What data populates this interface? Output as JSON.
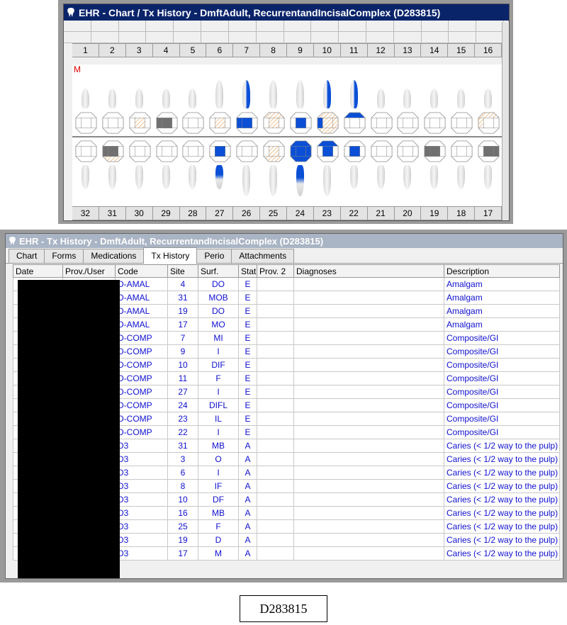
{
  "chart_window": {
    "title": "EHR - Chart / Tx History - DmftAdult, RecurrentandIncisalComplex (D283815)",
    "mesial_marker": "M",
    "upper_tooth_numbers": [
      "1",
      "2",
      "3",
      "4",
      "5",
      "6",
      "7",
      "8",
      "9",
      "10",
      "11",
      "12",
      "13",
      "14",
      "15",
      "16"
    ],
    "lower_tooth_numbers": [
      "32",
      "31",
      "30",
      "29",
      "28",
      "27",
      "26",
      "25",
      "24",
      "23",
      "22",
      "21",
      "20",
      "19",
      "18",
      "17"
    ],
    "colors": {
      "existing_restoration": "#0a4fd6",
      "amalgam": "#707070",
      "caries_hatch": "#f0b070",
      "titlebar": "#0a246a"
    }
  },
  "tx_window": {
    "title": "EHR - Tx History - DmftAdult, RecurrentandIncisalComplex (D283815)",
    "tabs": [
      "Chart",
      "Forms",
      "Medications",
      "Tx History",
      "Perio",
      "Attachments"
    ],
    "active_tab": "Tx History",
    "columns": [
      "Date",
      "Prov./User",
      "Code",
      "Site",
      "Surf.",
      "Stat",
      "Prov. 2",
      "Diagnoses",
      "Description"
    ],
    "rows": [
      {
        "code": "D-AMAL",
        "site": "4",
        "surf": "DO",
        "stat": "E",
        "desc": "Amalgam"
      },
      {
        "code": "D-AMAL",
        "site": "31",
        "surf": "MOB",
        "stat": "E",
        "desc": "Amalgam"
      },
      {
        "code": "D-AMAL",
        "site": "19",
        "surf": "DO",
        "stat": "E",
        "desc": "Amalgam"
      },
      {
        "code": "D-AMAL",
        "site": "17",
        "surf": "MO",
        "stat": "E",
        "desc": "Amalgam"
      },
      {
        "code": "D-COMP",
        "site": "7",
        "surf": "MI",
        "stat": "E",
        "desc": "Composite/GI"
      },
      {
        "code": "D-COMP",
        "site": "9",
        "surf": "I",
        "stat": "E",
        "desc": "Composite/GI"
      },
      {
        "code": "D-COMP",
        "site": "10",
        "surf": "DIF",
        "stat": "E",
        "desc": "Composite/GI"
      },
      {
        "code": "D-COMP",
        "site": "11",
        "surf": "F",
        "stat": "E",
        "desc": "Composite/GI"
      },
      {
        "code": "D-COMP",
        "site": "27",
        "surf": "I",
        "stat": "E",
        "desc": "Composite/GI"
      },
      {
        "code": "D-COMP",
        "site": "24",
        "surf": "DIFL",
        "stat": "E",
        "desc": "Composite/GI"
      },
      {
        "code": "D-COMP",
        "site": "23",
        "surf": "IL",
        "stat": "E",
        "desc": "Composite/GI"
      },
      {
        "code": "D-COMP",
        "site": "22",
        "surf": "I",
        "stat": "E",
        "desc": "Composite/GI"
      },
      {
        "code": "D3",
        "site": "31",
        "surf": "MB",
        "stat": "A",
        "desc": "Caries (< 1/2 way to the pulp)"
      },
      {
        "code": "D3",
        "site": "3",
        "surf": "O",
        "stat": "A",
        "desc": "Caries (< 1/2 way to the pulp)"
      },
      {
        "code": "D3",
        "site": "6",
        "surf": "I",
        "stat": "A",
        "desc": "Caries (< 1/2 way to the pulp)"
      },
      {
        "code": "D3",
        "site": "8",
        "surf": "IF",
        "stat": "A",
        "desc": "Caries (< 1/2 way to the pulp)"
      },
      {
        "code": "D3",
        "site": "10",
        "surf": "DF",
        "stat": "A",
        "desc": "Caries (< 1/2 way to the pulp)"
      },
      {
        "code": "D3",
        "site": "16",
        "surf": "MB",
        "stat": "A",
        "desc": "Caries (< 1/2 way to the pulp)"
      },
      {
        "code": "D3",
        "site": "25",
        "surf": "F",
        "stat": "A",
        "desc": "Caries (< 1/2 way to the pulp)"
      },
      {
        "code": "D3",
        "site": "19",
        "surf": "D",
        "stat": "A",
        "desc": "Caries (< 1/2 way to the pulp)"
      },
      {
        "code": "D3",
        "site": "17",
        "surf": "M",
        "stat": "A",
        "desc": "Caries (< 1/2 way to the pulp)"
      }
    ]
  },
  "caption": "D283815"
}
